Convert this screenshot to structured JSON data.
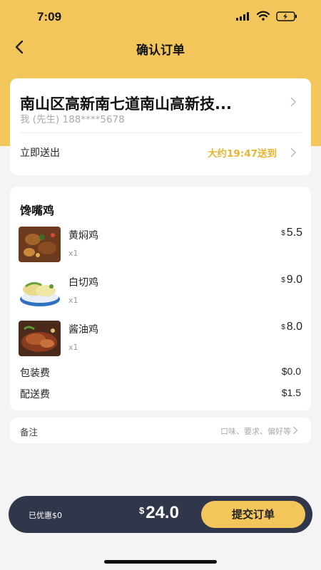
{
  "status_bar": {
    "time": "7:09"
  },
  "nav": {
    "title": "确认订单"
  },
  "address": {
    "line": "南山区高新南七道南山高新技...",
    "contact": "我 (先生) 188****5678",
    "deliver_label": "立即送出",
    "deliver_time": "大约19:47送到"
  },
  "order": {
    "shop_name": "馋嘴鸡",
    "items": [
      {
        "name": "黄焖鸡",
        "qty": "x1",
        "currency": "$",
        "price": "5.5"
      },
      {
        "name": "白切鸡",
        "qty": "x1",
        "currency": "$",
        "price": "9.0"
      },
      {
        "name": "酱油鸡",
        "qty": "x1",
        "currency": "$",
        "price": "8.0"
      }
    ],
    "fees": [
      {
        "label": "包装费",
        "value": "$0.0"
      },
      {
        "label": "配送费",
        "value": "$1.5"
      }
    ]
  },
  "note": {
    "label": "备注",
    "hint": "口味、要求、偏好等"
  },
  "checkout": {
    "saved": "已优惠$0",
    "currency": "$",
    "total": "24.0",
    "submit_label": "提交订单"
  },
  "colors": {
    "accent": "#f2c65a",
    "highlight": "#e6b532",
    "bar": "#30374a"
  }
}
